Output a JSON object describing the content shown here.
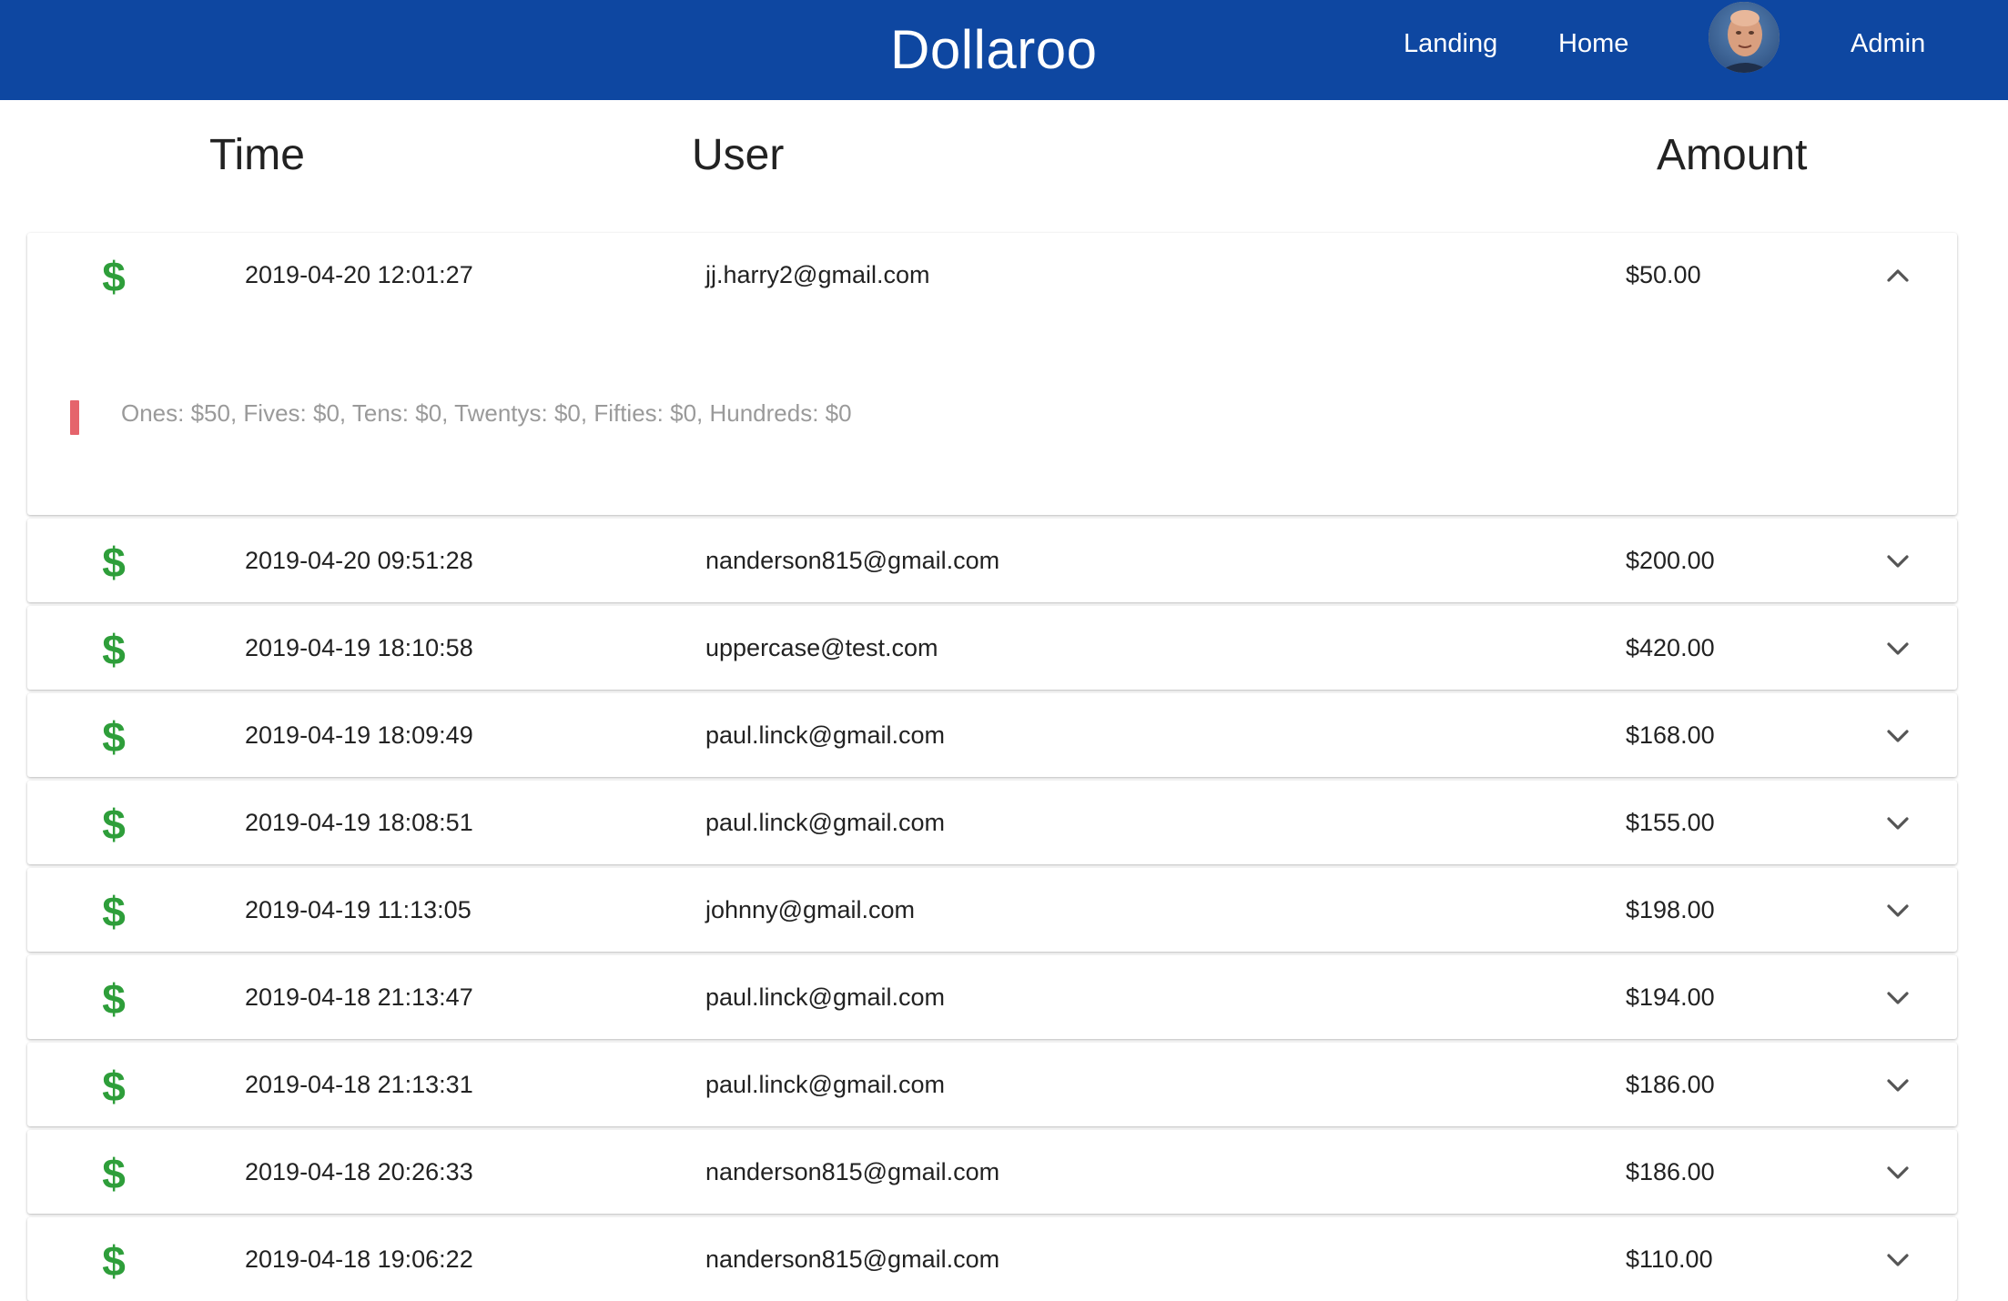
{
  "navbar": {
    "brand": "Dollaroo",
    "links": [
      "Landing",
      "Home",
      "Admin"
    ]
  },
  "columns": {
    "time": "Time",
    "user": "User",
    "amount": "Amount"
  },
  "colors": {
    "nav_bg": "#0e47a1",
    "dollar_icon": "#2e9e3a",
    "detail_accent": "#e5646c"
  },
  "transactions": [
    {
      "time": "2019-04-20 12:01:27",
      "user": "jj.harry2@gmail.com",
      "amount": "$50.00",
      "expanded": true,
      "detail": "Ones: $50, Fives: $0, Tens: $0, Twentys: $0, Fifties: $0, Hundreds: $0"
    },
    {
      "time": "2019-04-20 09:51:28",
      "user": "nanderson815@gmail.com",
      "amount": "$200.00",
      "expanded": false
    },
    {
      "time": "2019-04-19 18:10:58",
      "user": "uppercase@test.com",
      "amount": "$420.00",
      "expanded": false
    },
    {
      "time": "2019-04-19 18:09:49",
      "user": "paul.linck@gmail.com",
      "amount": "$168.00",
      "expanded": false
    },
    {
      "time": "2019-04-19 18:08:51",
      "user": "paul.linck@gmail.com",
      "amount": "$155.00",
      "expanded": false
    },
    {
      "time": "2019-04-19 11:13:05",
      "user": "johnny@gmail.com",
      "amount": "$198.00",
      "expanded": false
    },
    {
      "time": "2019-04-18 21:13:47",
      "user": "paul.linck@gmail.com",
      "amount": "$194.00",
      "expanded": false
    },
    {
      "time": "2019-04-18 21:13:31",
      "user": "paul.linck@gmail.com",
      "amount": "$186.00",
      "expanded": false
    },
    {
      "time": "2019-04-18 20:26:33",
      "user": "nanderson815@gmail.com",
      "amount": "$186.00",
      "expanded": false
    },
    {
      "time": "2019-04-18 19:06:22",
      "user": "nanderson815@gmail.com",
      "amount": "$110.00",
      "expanded": false
    }
  ]
}
